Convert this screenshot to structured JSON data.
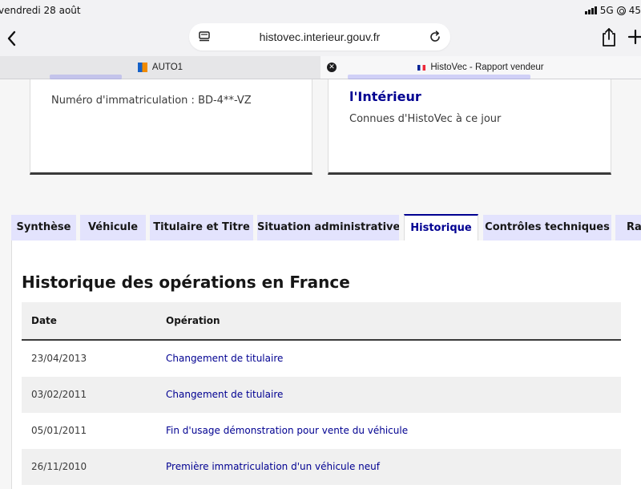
{
  "status_bar": {
    "time": "vendredi 28 août",
    "network": "5G",
    "battery": "45"
  },
  "browser": {
    "url": "histovec.interieur.gouv.fr",
    "tabs": [
      {
        "title": "AUTO1",
        "icon": "auto1-favicon"
      },
      {
        "title": "HistoVec - Rapport vendeur",
        "icon": "france-flag-favicon",
        "active": true
      }
    ]
  },
  "cards": {
    "left": {
      "text": "Numéro d'immatriculation : BD-4**-VZ"
    },
    "right": {
      "title": "l'Intérieur",
      "text": "Connues d'HistoVec à ce jour"
    }
  },
  "report_tabs": [
    {
      "label": "Synthèse"
    },
    {
      "label": "Véhicule"
    },
    {
      "label": "Titulaire et Titre"
    },
    {
      "label": "Situation administrative"
    },
    {
      "label": "Historique",
      "active": true
    },
    {
      "label": "Contrôles techniques"
    },
    {
      "label": "Rap"
    }
  ],
  "history": {
    "title": "Historique des opérations en France",
    "columns": [
      "Date",
      "Opération"
    ],
    "rows": [
      {
        "date": "23/04/2013",
        "operation": "Changement de titulaire"
      },
      {
        "date": "03/02/2011",
        "operation": "Changement de titulaire"
      },
      {
        "date": "05/01/2011",
        "operation": "Fin d'usage démonstration pour vente du véhicule"
      },
      {
        "date": "26/11/2010",
        "operation": "Première immatriculation d'un véhicule neuf"
      }
    ]
  },
  "colors": {
    "brand_blue": "#000091",
    "tab_bg": "#e3e3fd",
    "row_alt": "#f0f0f0"
  }
}
